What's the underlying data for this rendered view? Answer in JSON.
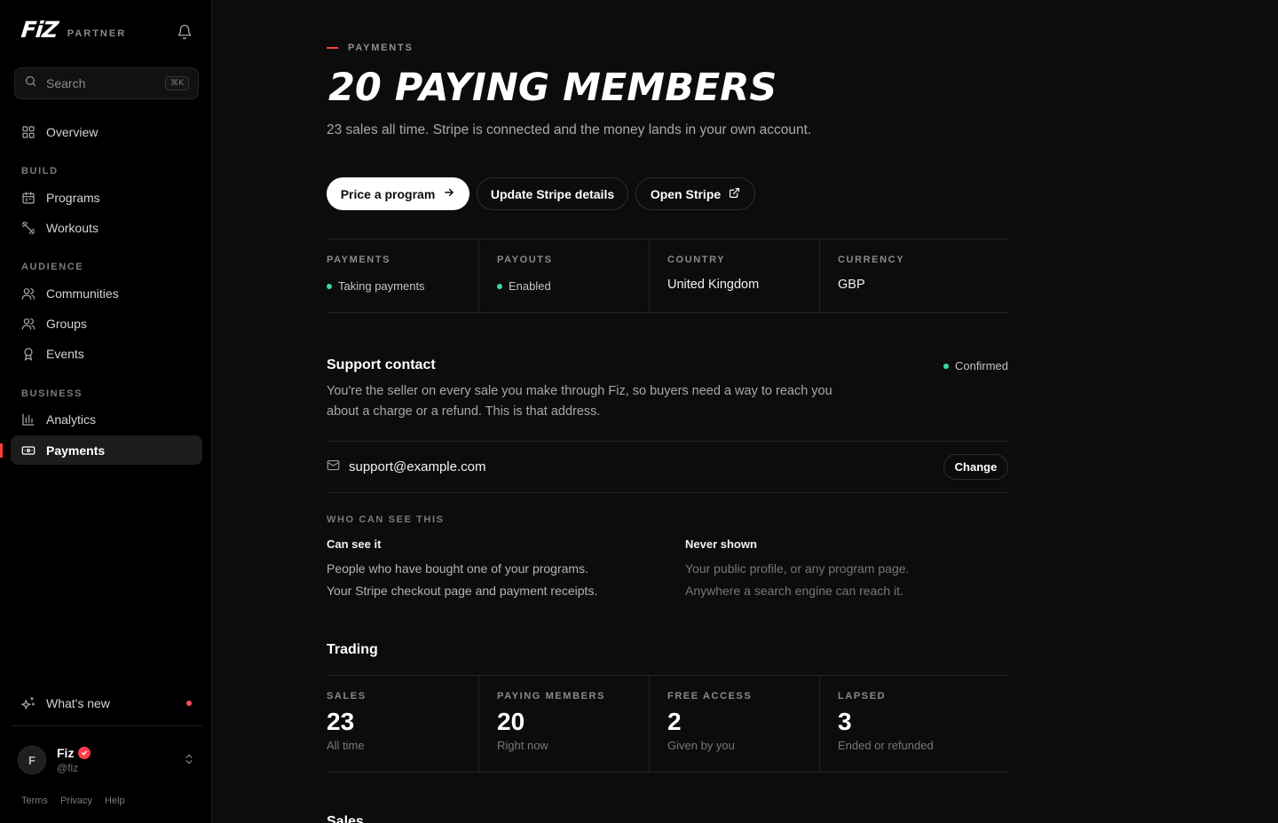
{
  "sidebar": {
    "logo": "FiZ",
    "partner": "PARTNER",
    "search": {
      "placeholder": "Search",
      "shortcut": "⌘K"
    },
    "overview": "Overview",
    "sections": {
      "build": "BUILD",
      "audience": "AUDIENCE",
      "business": "BUSINESS"
    },
    "items": {
      "programs": "Programs",
      "workouts": "Workouts",
      "communities": "Communities",
      "groups": "Groups",
      "events": "Events",
      "analytics": "Analytics",
      "payments": "Payments"
    },
    "active": "payments",
    "whats_new": "What's new",
    "user": {
      "initial": "F",
      "name": "Fiz",
      "handle": "@fiz"
    },
    "footer": {
      "terms": "Terms",
      "privacy": "Privacy",
      "help": "Help"
    }
  },
  "main": {
    "eyebrow": "PAYMENTS",
    "title": "20 PAYING MEMBERS",
    "subtitle": "23 sales all time. Stripe is connected and the money lands in your own account.",
    "actions": {
      "price_program": "Price a program",
      "update_stripe": "Update Stripe details",
      "open_stripe": "Open Stripe"
    },
    "status": {
      "payments_label": "PAYMENTS",
      "payments_value": "Taking payments",
      "payouts_label": "PAYOUTS",
      "payouts_value": "Enabled",
      "country_label": "COUNTRY",
      "country_value": "United Kingdom",
      "currency_label": "CURRENCY",
      "currency_value": "GBP"
    },
    "support": {
      "title": "Support contact",
      "badge": "Confirmed",
      "description": "You're the seller on every sale you make through Fiz, so buyers need a way to reach you about a charge or a refund. This is that address.",
      "email": "support@example.com",
      "change": "Change",
      "visibility_label": "WHO CAN SEE THIS",
      "can_see": {
        "title": "Can see it",
        "lines": [
          "People who have bought one of your programs.",
          "Your Stripe checkout page and payment receipts."
        ]
      },
      "never_shown": {
        "title": "Never shown",
        "lines": [
          "Your public profile, or any program page.",
          "Anywhere a search engine can reach it."
        ]
      }
    },
    "trading": {
      "title": "Trading",
      "stats": [
        {
          "label": "SALES",
          "value": "23",
          "caption": "All time"
        },
        {
          "label": "PAYING MEMBERS",
          "value": "20",
          "caption": "Right now"
        },
        {
          "label": "FREE ACCESS",
          "value": "2",
          "caption": "Given by you"
        },
        {
          "label": "LAPSED",
          "value": "3",
          "caption": "Ended or refunded"
        }
      ]
    },
    "next_section": "Sales"
  },
  "colors": {
    "accent": "#ff3b3b",
    "status_ok": "#3ddc97",
    "background": "#0c0c0c",
    "sidebar": "#000000"
  }
}
